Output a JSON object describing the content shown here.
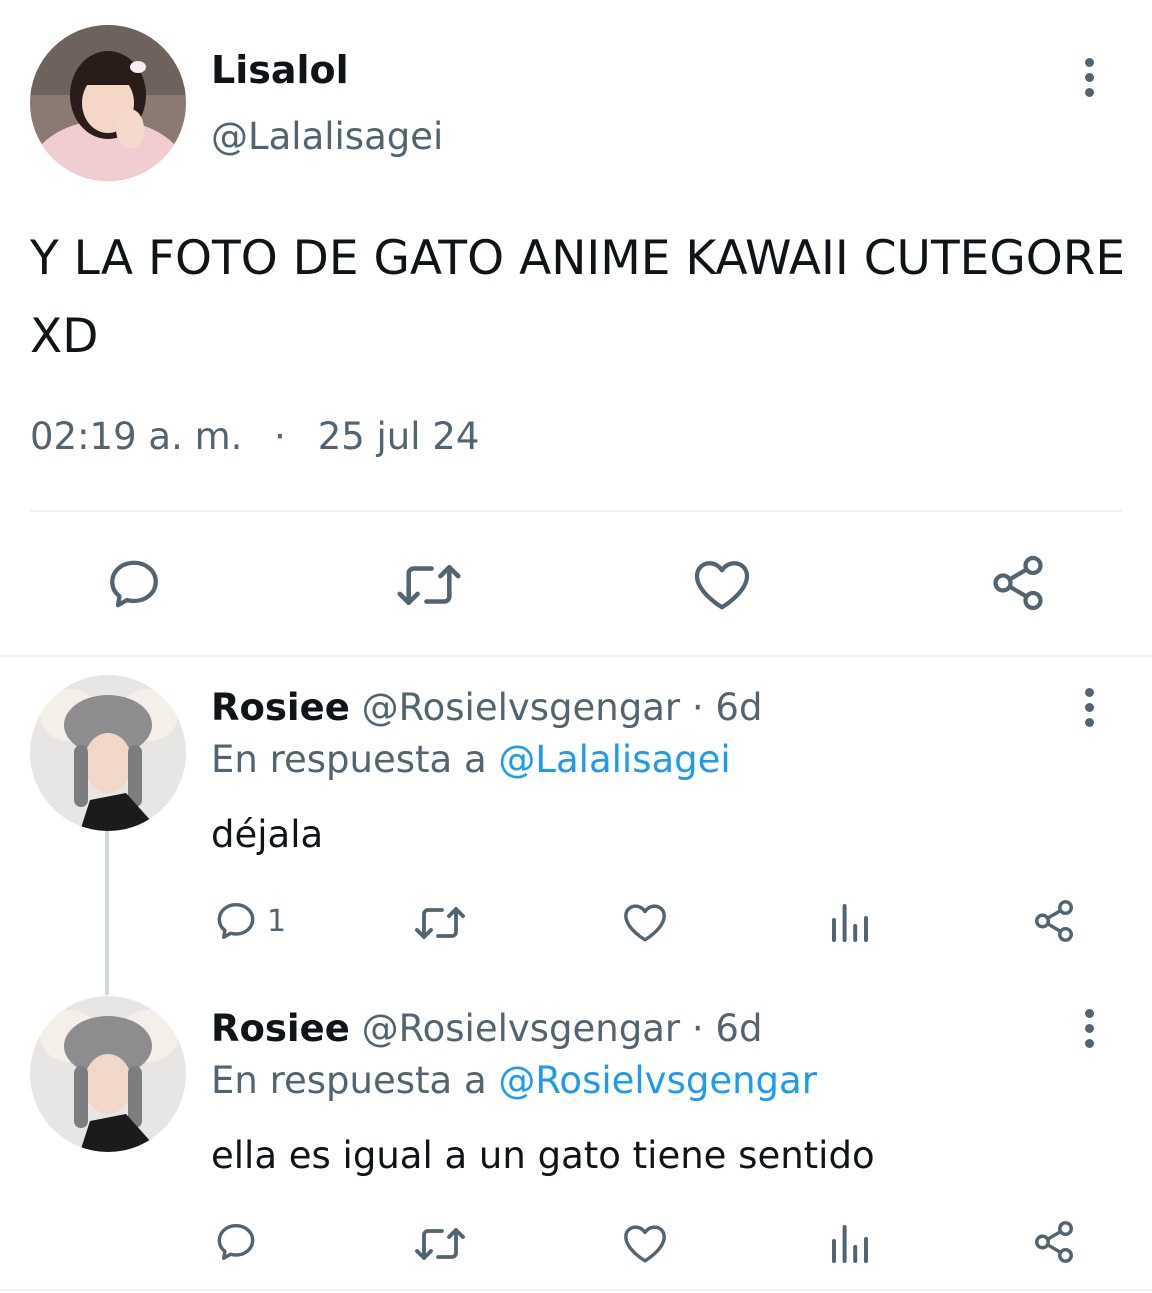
{
  "main_tweet": {
    "display_name": "Lisalol",
    "handle": "@Lalalisagei",
    "text": "Y LA FOTO DE GATO ANIME KAWAII CUTEGORE XD",
    "time": "02:19 a. m.",
    "separator": "·",
    "date": "25 jul 24",
    "actions": [
      "reply-icon",
      "retweet-icon",
      "like-icon",
      "share-icon"
    ]
  },
  "replies": [
    {
      "display_name": "Rosiee",
      "handle": "@Rosielvsgengar",
      "age": "· 6d",
      "reply_to_prefix": "En respuesta a",
      "reply_to_handle": "@Lalalisagei",
      "text": "déjala",
      "reply_count": "1"
    },
    {
      "display_name": "Rosiee",
      "handle": "@Rosielvsgengar",
      "age": "· 6d",
      "reply_to_prefix": "En respuesta a",
      "reply_to_handle": "@Rosielvsgengar",
      "text": "ella es igual a un gato tiene sentido",
      "reply_count": ""
    }
  ],
  "colors": {
    "text": "#0f1419",
    "muted": "#536471",
    "link": "#1d9bf0",
    "divider": "#eff3f4"
  }
}
